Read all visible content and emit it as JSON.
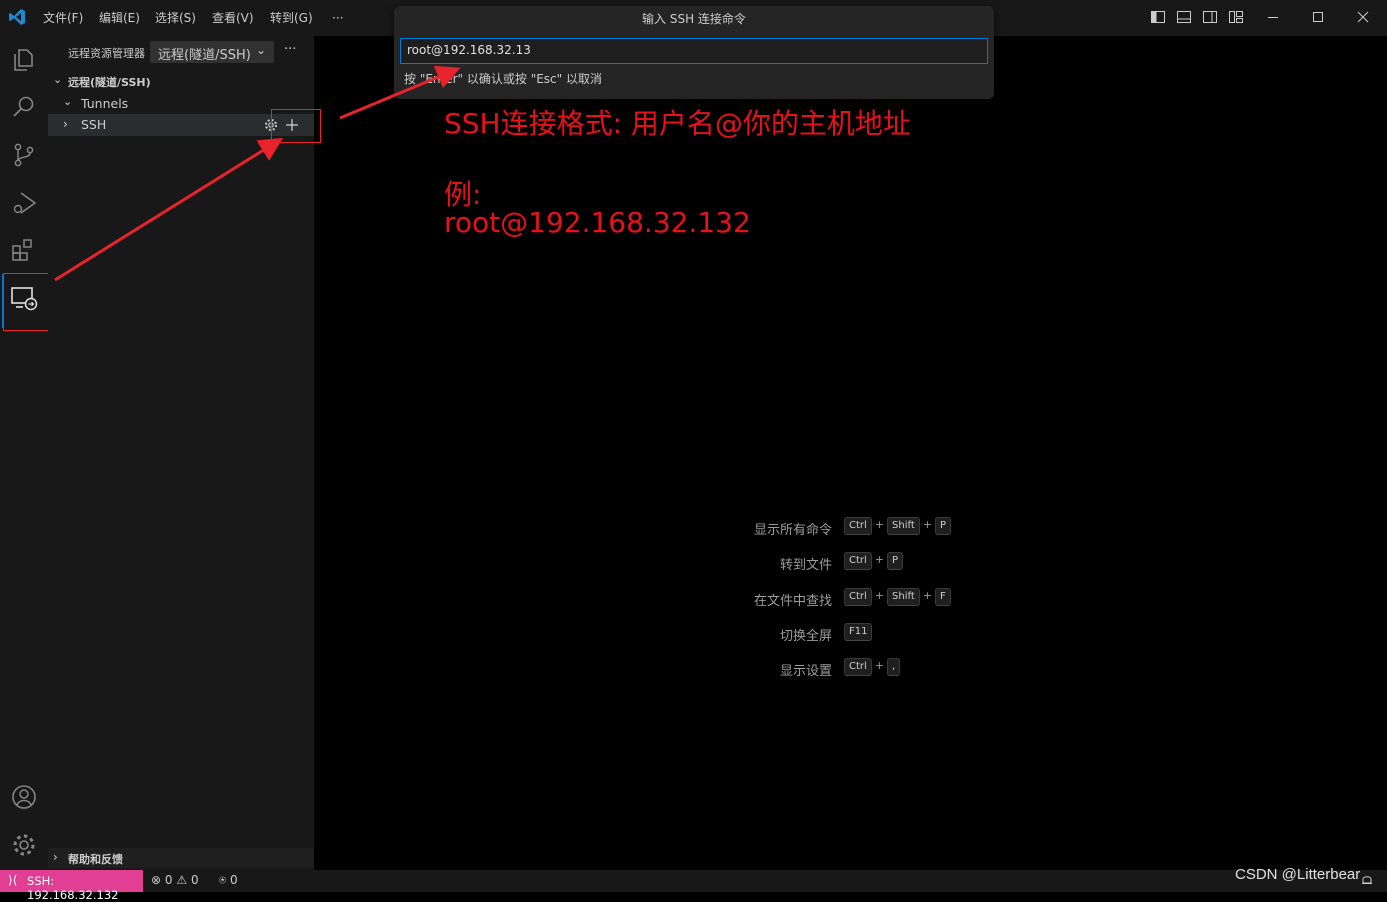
{
  "menu": [
    "文件(F)",
    "编辑(E)",
    "选择(S)",
    "查看(V)",
    "转到(G)",
    "···"
  ],
  "quick_input": {
    "title": "输入 SSH 连接命令",
    "value": "root@192.168.32.13",
    "hint": "按 \"Enter\" 以确认或按 \"Esc\" 以取消"
  },
  "sidebar": {
    "title": "远程资源管理器",
    "dropdown": "远程(隧道/SSH)",
    "more": "···",
    "section": "远程(隧道/SSH)",
    "tree": [
      {
        "label": "Tunnels",
        "expanded": true
      },
      {
        "label": "SSH",
        "expanded": false
      }
    ],
    "footer": "帮助和反馈"
  },
  "annotation": {
    "line1": "SSH连接格式:  用户名@你的主机地址",
    "line2": "例:",
    "line3": "root@192.168.32.132"
  },
  "shortcuts": [
    {
      "label": "显示所有命令",
      "keys": [
        "Ctrl",
        "Shift",
        "P"
      ]
    },
    {
      "label": "转到文件",
      "keys": [
        "Ctrl",
        "P"
      ]
    },
    {
      "label": "在文件中查找",
      "keys": [
        "Ctrl",
        "Shift",
        "F"
      ]
    },
    {
      "label": "切换全屏",
      "keys": [
        "F11"
      ]
    },
    {
      "label": "显示设置",
      "keys": [
        "Ctrl",
        ","
      ]
    }
  ],
  "status": {
    "remote": "SSH: 192.168.32.132",
    "errors": "0",
    "warnings": "0",
    "ports": "0",
    "remote_color": "#e13f93"
  },
  "watermark": "CSDN @Litterbear",
  "colors": {
    "accent": "#0078d4",
    "annotation": "#e8101a"
  }
}
